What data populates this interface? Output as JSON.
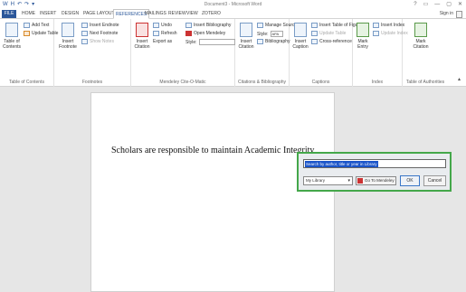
{
  "window": {
    "title": "Document3 - Microsoft Word",
    "controls": [
      "?",
      "▭",
      "—",
      "▢",
      "✕"
    ]
  },
  "quick_access": [
    "W",
    "H",
    "↶",
    "↷",
    "▾"
  ],
  "tabs": {
    "file": "FILE",
    "items": [
      "HOME",
      "INSERT",
      "DESIGN",
      "PAGE LAYOUT",
      "REFERENCES",
      "MAILINGS",
      "REVIEW",
      "VIEW",
      "ZOTERO"
    ],
    "active": "REFERENCES",
    "sign_in": "Sign in"
  },
  "ribbon": {
    "toc": {
      "big_label": "Table of Contents",
      "add_text": "Add Text",
      "update_table": "Update Table",
      "group_label": "Table of Contents"
    },
    "footnotes": {
      "insert_footnote": "Insert Footnote",
      "insert_endnote": "Insert Endnote",
      "next_footnote": "Next Footnote",
      "show_notes": "Show Notes",
      "group_label": "Footnotes"
    },
    "mendeley": {
      "insert_citation": "Insert Citation",
      "undo": "Undo",
      "refresh": "Refresh",
      "export": "Export as",
      "style_label": "Style:",
      "insert_bibliography": "Insert Bibliography",
      "open_mendeley": "Open Mendeley",
      "group_label": "Mendeley Cite-O-Matic"
    },
    "citations": {
      "insert_citation": "Insert Citation",
      "manage_sources": "Manage Sources",
      "style": "Style:",
      "style_value": "APA",
      "bibliography": "Bibliography",
      "group_label": "Citations & Bibliography"
    },
    "captions": {
      "insert_caption": "Insert Caption",
      "insert_tof": "Insert Table of Figures",
      "update_table": "Update Table",
      "cross_reference": "Cross-reference",
      "group_label": "Captions"
    },
    "index": {
      "mark_entry": "Mark Entry",
      "insert_index": "Insert Index",
      "update_index": "Update Index",
      "group_label": "Index"
    },
    "authorities": {
      "mark_citation": "Mark Citation",
      "group_label": "Table of Authorities"
    }
  },
  "document": {
    "body_text": "Scholars are responsible to maintain Academic Integrity"
  },
  "zotero_dialog": {
    "search_text": "Search by author, title or year in Library",
    "library": "My Library",
    "go_to_mendeley": "Go To Mendeley",
    "ok": "OK",
    "cancel": "Cancel"
  }
}
